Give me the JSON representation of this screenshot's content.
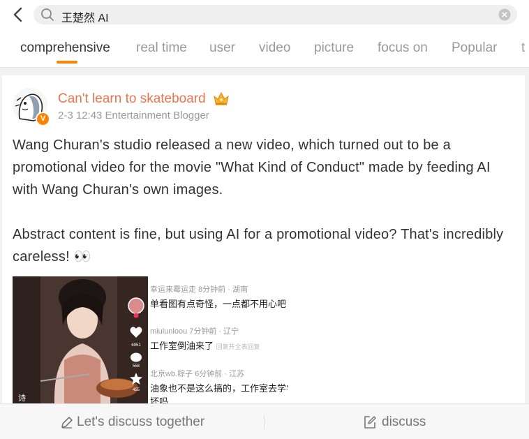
{
  "search": {
    "query": "王楚然 AI"
  },
  "tabs": [
    "comprehensive",
    "real time",
    "user",
    "video",
    "picture",
    "focus on",
    "Popular",
    "t"
  ],
  "post": {
    "username": "Can't learn to skateboard",
    "meta": "2-3 12:43 Entertainment Blogger",
    "paragraph1": "Wang Churan's studio released a new video, which turned out to be a promotional video for the movie \"What Kind of Conduct\" made by feeding AI with Wang Churan's own images.",
    "paragraph2": "Abstract content is fine, but using AI for a promotional video? That's incredibly careless! 👀",
    "media": {
      "comments": [
        {
          "meta_user": "幸运来霉运走",
          "meta_time": "8分钟前 · 湖南",
          "text": "单看图有点奇怪，一点都不用心吧"
        },
        {
          "meta_user": "miulunloou",
          "meta_time": "7分钟前 · 辽宁",
          "text": "工作室倒油来了",
          "extra": "回复开全表回复"
        },
        {
          "meta_user": "北京wb.粽子",
          "meta_time": "6分钟前 · 江苏",
          "text": "油象也不是这么搞的，工作室去学学",
          "text2": "坏吗"
        }
      ],
      "video_counts": {
        "likes": "6951",
        "comments": "558",
        "stars": "455"
      },
      "corner_text": "诗"
    }
  },
  "bottom": {
    "discuss_together": "Let's discuss together",
    "discuss": "discuss"
  },
  "colors": {
    "accent": "#ff8200",
    "username": "#eb7350"
  }
}
